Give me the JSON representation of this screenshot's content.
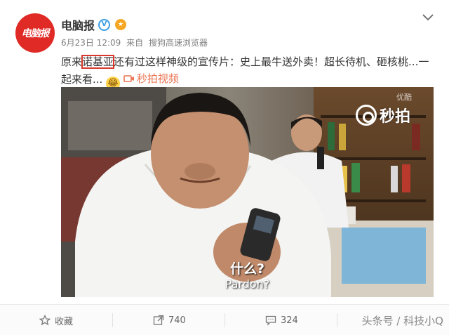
{
  "post": {
    "avatar_text": "电脑报",
    "author": "电脑报",
    "verified_badge": "V",
    "medal_icon": "medal-icon",
    "date": "6月23日 12:09",
    "source_prefix": "来自",
    "source": "搜狗高速浏览器",
    "text_before": "原来",
    "text_highlight": "诺基亚",
    "text_after": "还有过这样神级的宣传片：史上最牛送外卖！超长待机、砸核桃...一起来看...",
    "emoji_icon": "laugh-cry-emoji",
    "video_link": "秒拍视频"
  },
  "video": {
    "watermark_text": "秒拍",
    "watermark_small": "优酷",
    "subtitle_cn": "什么?",
    "subtitle_en": "Pardon?"
  },
  "footer": {
    "favorite": "收藏",
    "repost_count": "740",
    "comment_count": "324",
    "credit": "头条号 / 科技小Q"
  },
  "colors": {
    "brand_red": "#e02a26",
    "link_orange": "#eb7350",
    "verify_blue": "#3b9ee5",
    "highlight_box": "#d9372c"
  }
}
